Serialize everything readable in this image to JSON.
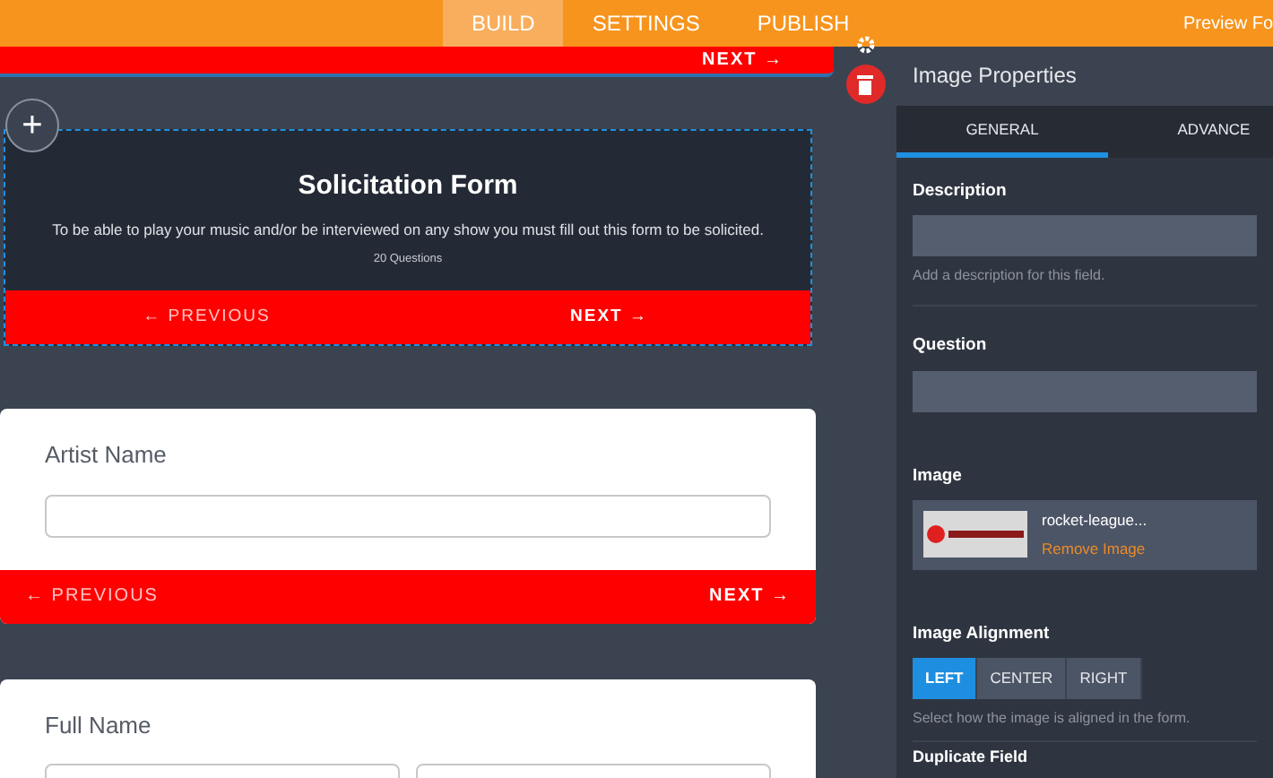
{
  "top_bar": {
    "tabs": [
      {
        "label": "BUILD",
        "selected": true
      },
      {
        "label": "SETTINGS",
        "selected": false
      },
      {
        "label": "PUBLISH",
        "selected": false
      }
    ],
    "preview": "Preview Fo"
  },
  "canvas": {
    "top_card": {
      "next": "NEXT →"
    },
    "welcome_card": {
      "selected": true,
      "title": "Solicitation Form",
      "description": "To be able to play your music and/or be interviewed on any show you must fill out this form to be solicited.",
      "count": "20 Questions",
      "previous": "← PREVIOUS",
      "next": "NEXT →"
    },
    "add_button": "+",
    "questions": [
      {
        "label": "Artist Name",
        "kind": "single",
        "previous": "← PREVIOUS",
        "next": "NEXT →"
      },
      {
        "label": "Full Name",
        "kind": "split"
      }
    ]
  },
  "panel": {
    "title": "Image Properties",
    "tabs": [
      {
        "label": "GENERAL",
        "selected": true
      },
      {
        "label": "ADVANCE",
        "selected": false
      }
    ],
    "description": {
      "label": "Description",
      "hint": "Add a description for this field."
    },
    "question": {
      "label": "Question"
    },
    "image": {
      "label": "Image",
      "file": "rocket-league...",
      "remove": "Remove Image"
    },
    "alignment": {
      "label": "Image Alignment",
      "options": [
        {
          "label": "LEFT",
          "selected": true
        },
        {
          "label": "CENTER",
          "selected": false
        },
        {
          "label": "RIGHT",
          "selected": false
        }
      ],
      "hint": "Select how the image is aligned in the form."
    },
    "duplicate": {
      "label": "Duplicate Field"
    }
  }
}
